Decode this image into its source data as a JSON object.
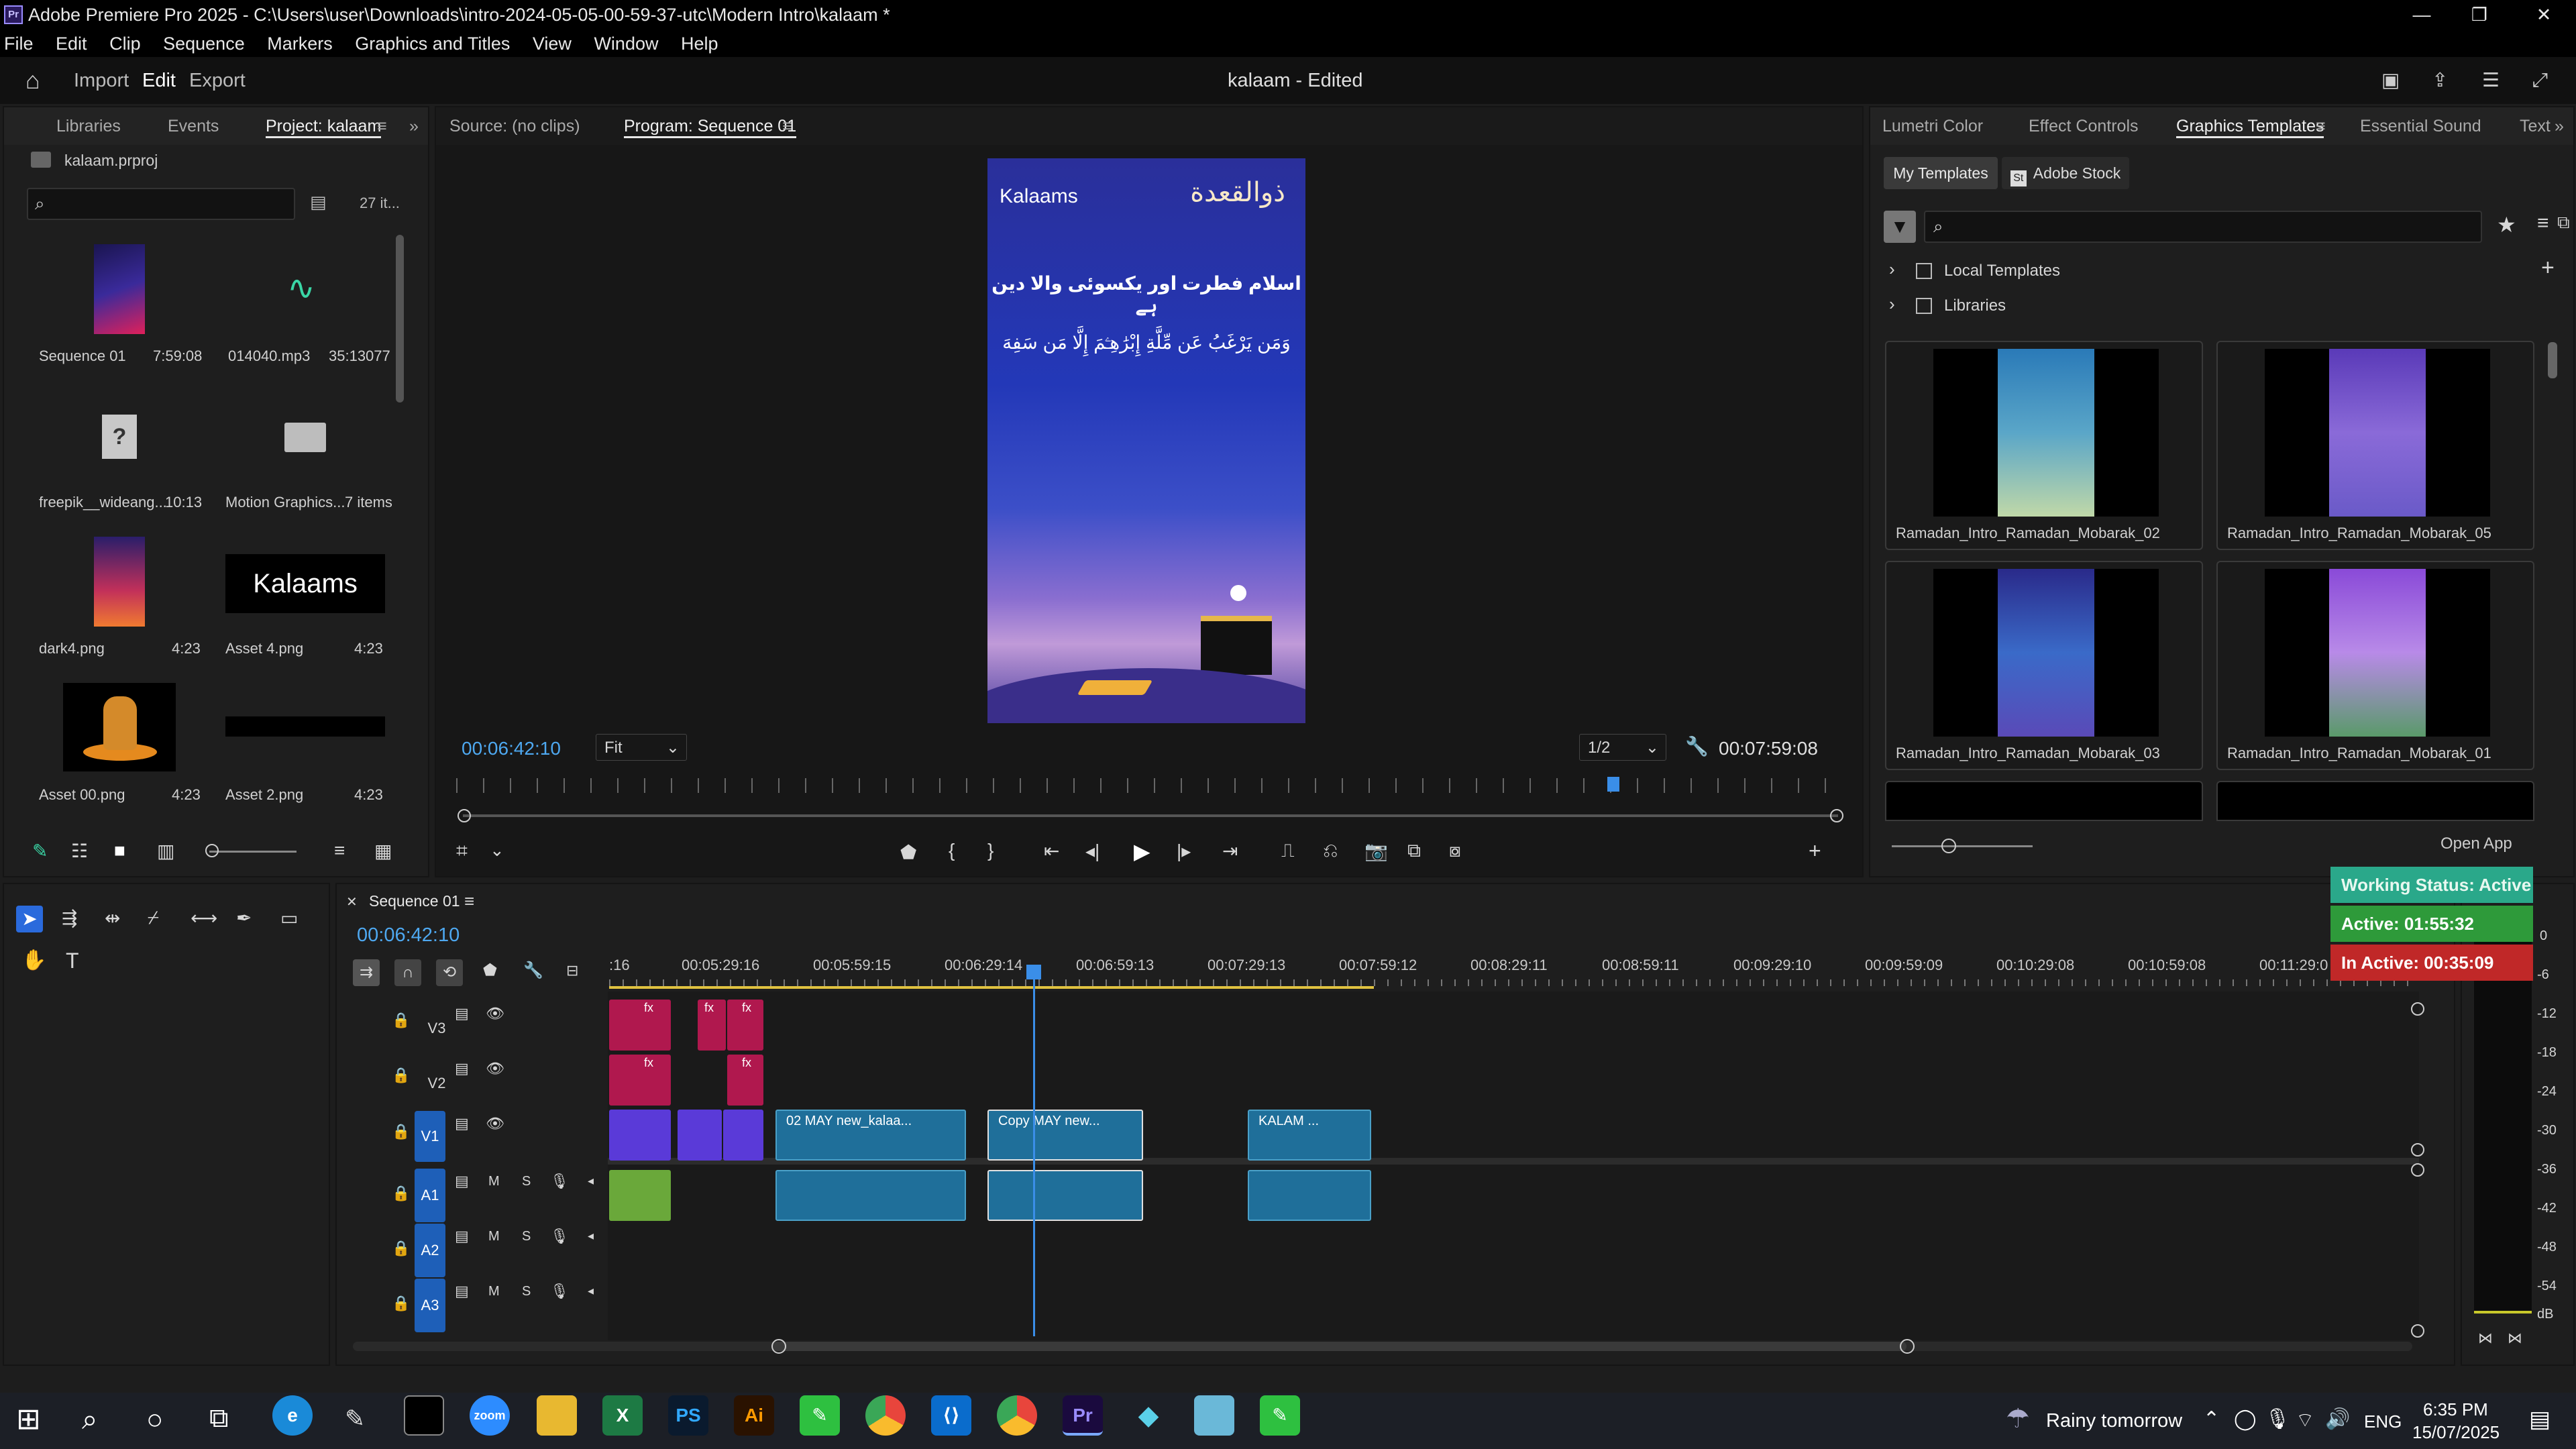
{
  "window": {
    "title": "Adobe Premiere Pro 2025 - C:\\Users\\user\\Downloads\\intro-2024-05-05-00-59-37-utc\\Modern Intro\\kalaam *",
    "minimize": "—",
    "maximize": "❐",
    "close": "✕"
  },
  "menu": [
    "File",
    "Edit",
    "Clip",
    "Sequence",
    "Markers",
    "Graphics and Titles",
    "View",
    "Window",
    "Help"
  ],
  "workspace": {
    "import": "Import",
    "edit": "Edit",
    "export": "Export",
    "doc_title": "kalaam - Edited"
  },
  "project_panel": {
    "tabs": [
      "Libraries",
      "Events",
      "Project: kalaam"
    ],
    "file": "kalaam.prproj",
    "count": "27 it...",
    "items": [
      {
        "name": "Sequence 01",
        "dur": "7:59:08"
      },
      {
        "name": "014040.mp3",
        "dur": "35:13077"
      },
      {
        "name": "freepik__wideang...",
        "dur": "10:13"
      },
      {
        "name": "Motion Graphics...",
        "dur": "7 items"
      },
      {
        "name": "dark4.png",
        "dur": "4:23"
      },
      {
        "name": "Asset 4.png",
        "dur": "4:23"
      },
      {
        "name": "Asset 00.png",
        "dur": "4:23"
      },
      {
        "name": "Asset 2.png",
        "dur": "4:23"
      }
    ]
  },
  "monitor": {
    "source_tab": "Source: (no clips)",
    "program_tab": "Program: Sequence 01",
    "timecode": "00:06:42:10",
    "fit": "Fit",
    "quality": "1/2",
    "duration": "00:07:59:08",
    "frame": {
      "logo": "Kalaams",
      "header_arabic": "ذوالقعدة",
      "line1": "اسلام فطرت اور یکسوئی والا دین ہے",
      "line2": "وَمَن يَرْغَبُ عَن مِّلَّةِ إِبْرَٰهِـۧمَ إِلَّا مَن سَفِهَ"
    }
  },
  "right_panel": {
    "tabs": [
      "Lumetri Color",
      "Effect Controls",
      "Graphics Templates",
      "Essential Sound",
      "Text"
    ],
    "my_templates": "My Templates",
    "adobe_stock": "Adobe Stock",
    "tree": [
      "Local Templates",
      "Libraries"
    ],
    "templates": [
      "Ramadan_Intro_Ramadan_Mobarak_02",
      "Ramadan_Intro_Ramadan_Mobarak_05",
      "Ramadan_Intro_Ramadan_Mobarak_03",
      "Ramadan_Intro_Ramadan_Mobarak_01"
    ],
    "open_app": "Open App"
  },
  "status_overlay": {
    "working": "Working Status: Active",
    "active": "Active: 01:55:32",
    "inactive": "In Active: 00:35:09"
  },
  "timeline": {
    "tab": "Sequence 01",
    "timecode": "00:06:42:10",
    "ruler": [
      ":16",
      "00:05:29:16",
      "00:05:59:15",
      "00:06:29:14",
      "00:06:59:13",
      "00:07:29:13",
      "00:07:59:12",
      "00:08:29:11",
      "00:08:59:11",
      "00:09:29:10",
      "00:09:59:09",
      "00:10:29:08",
      "00:10:59:08",
      "00:11:29:0"
    ],
    "tracks": [
      "V3",
      "V2",
      "V1",
      "A1",
      "A2",
      "A3"
    ],
    "clips": {
      "c1": "02 MAY new_kalaa...",
      "c2": "Copy MAY new...",
      "c3": "KALAM ..."
    },
    "fx": "fx",
    "m": "M",
    "s": "S"
  },
  "meter": {
    "labels": [
      "0",
      "-6",
      "-12",
      "-18",
      "-24",
      "-30",
      "-36",
      "-42",
      "-48",
      "-54",
      "dB"
    ]
  },
  "taskbar": {
    "weather": "Rainy tomorrow",
    "lang": "ENG",
    "time": "6:35 PM",
    "date": "15/07/2025",
    "apps": [
      "PS",
      "Ai",
      "Pr"
    ]
  }
}
